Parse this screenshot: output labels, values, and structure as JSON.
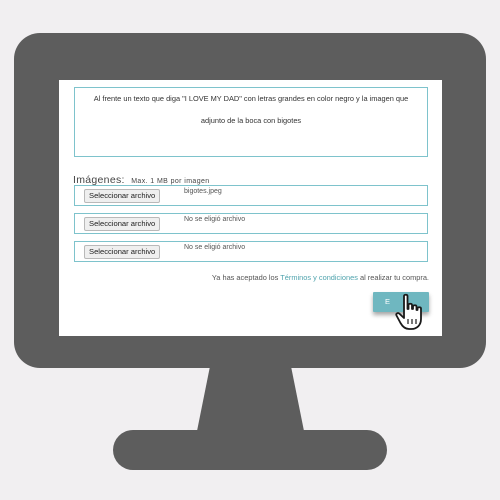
{
  "message": {
    "line1": "Al frente un texto que diga \"I LOVE MY DAD\" con letras grandes en color negro y la imagen que",
    "line2": "adjunto de la boca con bigotes"
  },
  "images": {
    "title": "Imágenes:",
    "hint": "Max. 1 MB por imagen",
    "inputs": [
      {
        "button_label": "Seleccionar archivo",
        "status": "bigotes.jpeg"
      },
      {
        "button_label": "Seleccionar archivo",
        "status": "No se eligió archivo"
      },
      {
        "button_label": "Seleccionar archivo",
        "status": "No se eligió archivo"
      }
    ]
  },
  "terms": {
    "prefix": "Ya has aceptado los",
    "link": "Términos y condiciones",
    "suffix": "al realizar tu compra."
  },
  "submit": {
    "label": "E"
  },
  "colors": {
    "accent": "#6fb7c0",
    "border": "#7ec3cc",
    "monitor": "#5d5d5d",
    "background": "#f1eff1"
  },
  "icons": {
    "cursor": "hand-pointer-icon"
  }
}
